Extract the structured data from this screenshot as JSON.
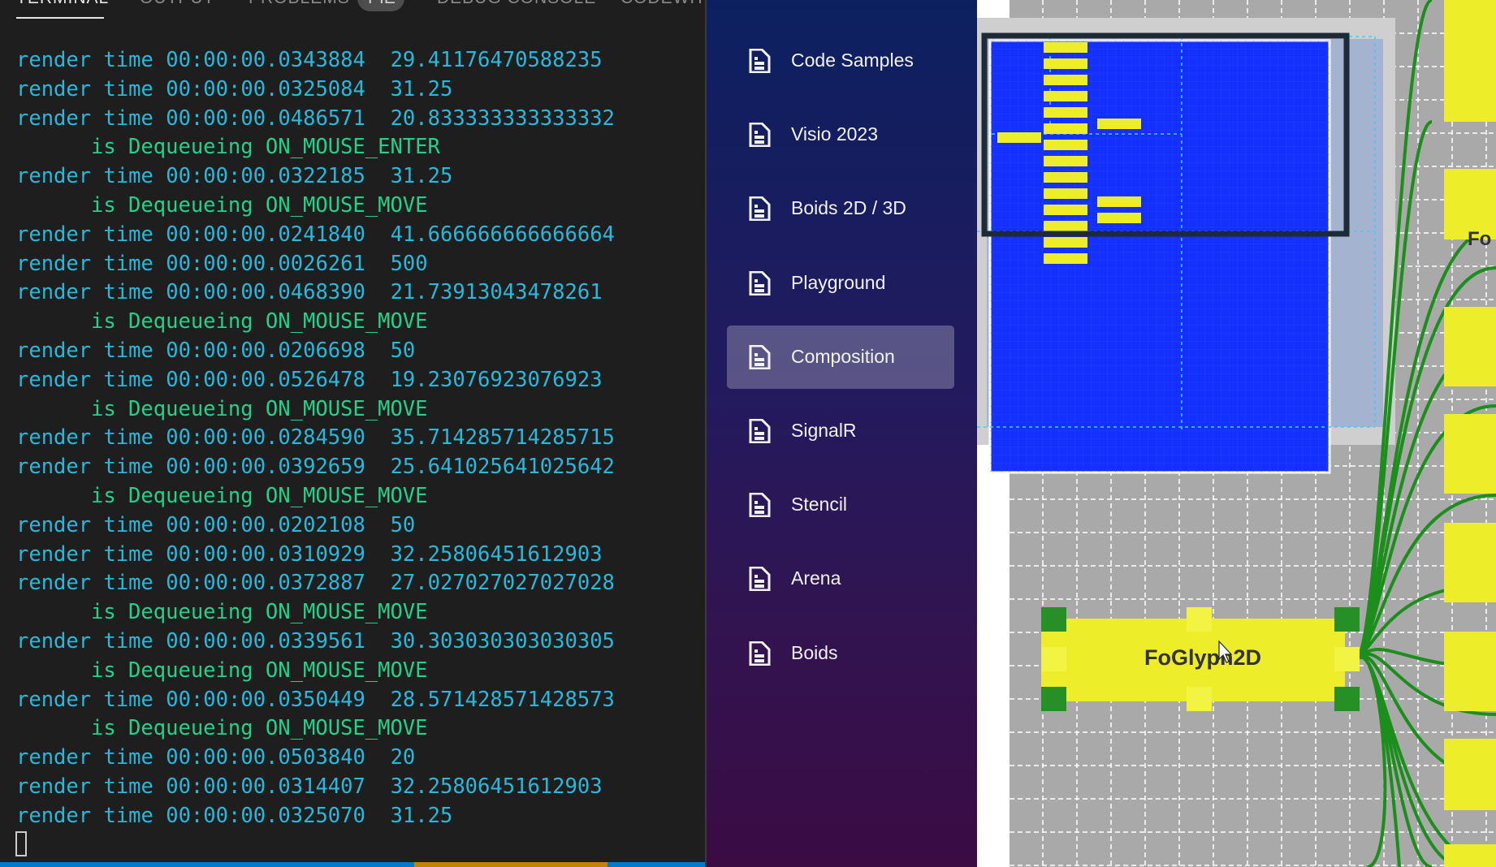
{
  "terminal": {
    "tabs": [
      "TERMINAL",
      "OUTPUT",
      "PROBLEMS",
      "PIE",
      "DEBUG CONSOLE",
      "CODEWH"
    ],
    "lines": [
      {
        "kind": "render",
        "text": "render time 00:00:00.0343884  29.41176470588235"
      },
      {
        "kind": "render",
        "text": "render time 00:00:00.0325084  31.25"
      },
      {
        "kind": "render",
        "text": "render time 00:00:00.0486571  20.833333333333332"
      },
      {
        "kind": "event",
        "text": "is Dequeueing ON_MOUSE_ENTER"
      },
      {
        "kind": "render",
        "text": "render time 00:00:00.0322185  31.25"
      },
      {
        "kind": "event",
        "text": "is Dequeueing ON_MOUSE_MOVE"
      },
      {
        "kind": "render",
        "text": "render time 00:00:00.0241840  41.666666666666664"
      },
      {
        "kind": "render",
        "text": "render time 00:00:00.0026261  500"
      },
      {
        "kind": "render",
        "text": "render time 00:00:00.0468390  21.73913043478261"
      },
      {
        "kind": "event",
        "text": "is Dequeueing ON_MOUSE_MOVE"
      },
      {
        "kind": "render",
        "text": "render time 00:00:00.0206698  50"
      },
      {
        "kind": "render",
        "text": "render time 00:00:00.0526478  19.23076923076923"
      },
      {
        "kind": "event",
        "text": "is Dequeueing ON_MOUSE_MOVE"
      },
      {
        "kind": "render",
        "text": "render time 00:00:00.0284590  35.714285714285715"
      },
      {
        "kind": "render",
        "text": "render time 00:00:00.0392659  25.641025641025642"
      },
      {
        "kind": "event",
        "text": "is Dequeueing ON_MOUSE_MOVE"
      },
      {
        "kind": "render",
        "text": "render time 00:00:00.0202108  50"
      },
      {
        "kind": "render",
        "text": "render time 00:00:00.0310929  32.25806451612903"
      },
      {
        "kind": "render",
        "text": "render time 00:00:00.0372887  27.027027027027028"
      },
      {
        "kind": "event",
        "text": "is Dequeueing ON_MOUSE_MOVE"
      },
      {
        "kind": "render",
        "text": "render time 00:00:00.0339561  30.303030303030305"
      },
      {
        "kind": "event",
        "text": "is Dequeueing ON_MOUSE_MOVE"
      },
      {
        "kind": "render",
        "text": "render time 00:00:00.0350449  28.571428571428573"
      },
      {
        "kind": "event",
        "text": "is Dequeueing ON_MOUSE_MOVE"
      },
      {
        "kind": "render",
        "text": "render time 00:00:00.0503840  20"
      },
      {
        "kind": "render",
        "text": "render time 00:00:00.0314407  32.25806451612903"
      },
      {
        "kind": "render",
        "text": "render time 00:00:00.0325070  31.25"
      }
    ]
  },
  "nav": {
    "selected": "Composition",
    "items": [
      {
        "label": "Code Samples",
        "icon": "document-icon"
      },
      {
        "label": "Visio 2023",
        "icon": "document-icon"
      },
      {
        "label": "Boids 2D / 3D",
        "icon": "document-icon"
      },
      {
        "label": "Playground",
        "icon": "document-icon"
      },
      {
        "label": "Composition",
        "icon": "document-icon"
      },
      {
        "label": "SignalR",
        "icon": "document-icon"
      },
      {
        "label": "Stencil",
        "icon": "document-icon"
      },
      {
        "label": "Arena",
        "icon": "document-icon"
      },
      {
        "label": "Boids",
        "icon": "document-icon"
      }
    ]
  },
  "canvas": {
    "glyph_label": "FoGlyph2D",
    "partial_label": "Fo",
    "colors": {
      "grid": "#a9a9a9",
      "blue": "#1430ff",
      "yellow": "#eded2a",
      "green": "#1c8e1c",
      "handle": "#268f26",
      "selection": "#1e2a36"
    }
  }
}
